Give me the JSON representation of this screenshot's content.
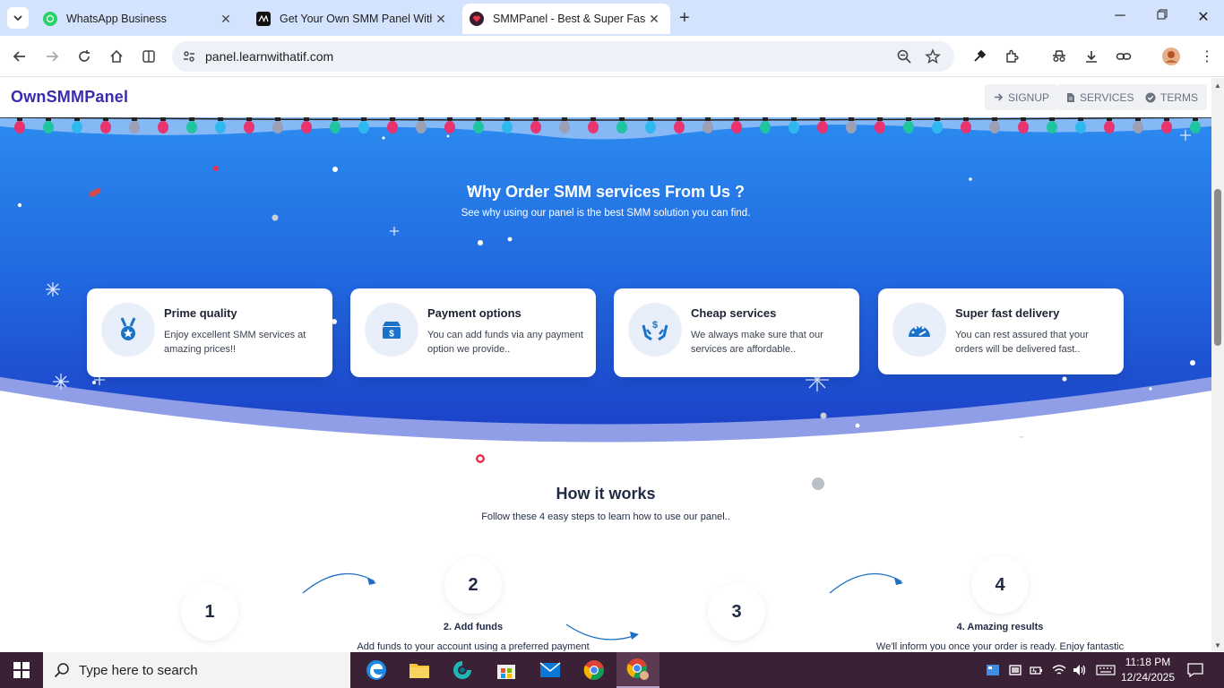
{
  "browser": {
    "tabs": [
      {
        "title": "WhatsApp Business",
        "active": false
      },
      {
        "title": "Get Your Own SMM Panel With",
        "active": false
      },
      {
        "title": "SMMPanel - Best & Super Fast S",
        "active": true
      }
    ],
    "url": "panel.learnwithatif.com"
  },
  "site": {
    "logo": "OwnSMMPanel",
    "nav": [
      {
        "label": "SIGNUP",
        "icon": "arrow-right-icon"
      },
      {
        "label": "SERVICES",
        "icon": "document-icon"
      },
      {
        "label": "TERMS",
        "icon": "check-circle-icon"
      }
    ]
  },
  "why": {
    "title": "Why Order SMM services From Us ?",
    "subtitle": "See why using our panel is the best SMM solution you can find.",
    "cards": [
      {
        "title": "Prime quality",
        "desc": "Enjoy excellent SMM services at amazing prices!!",
        "icon": "medal-icon"
      },
      {
        "title": "Payment options",
        "desc": "You can add funds via any payment option we provide..",
        "icon": "money-box-icon"
      },
      {
        "title": "Cheap services",
        "desc": "We always make sure that our services are affordable..",
        "icon": "hands-dollar-icon"
      },
      {
        "title": "Super fast delivery",
        "desc": "You can rest assured that your orders will be delivered fast..",
        "icon": "speedometer-icon"
      }
    ]
  },
  "how": {
    "title": "How it works",
    "subtitle": "Follow these 4 easy steps to learn how to use our panel..",
    "steps": [
      {
        "number": "1"
      },
      {
        "number": "2",
        "title": "2. Add funds",
        "desc": "Add funds to your account using a preferred payment"
      },
      {
        "number": "3"
      },
      {
        "number": "4",
        "title": "4. Amazing results",
        "desc": "We'll inform you once your order is ready. Enjoy fantastic"
      }
    ]
  },
  "taskbar": {
    "search_placeholder": "Type here to search",
    "time": "11:18 PM",
    "date": "12/24/2025"
  },
  "colors": {
    "accent": "#1a73e8",
    "hero_top": "#2a88ee",
    "hero_bottom": "#1d4fd1",
    "logo": "#3b2bb0"
  }
}
